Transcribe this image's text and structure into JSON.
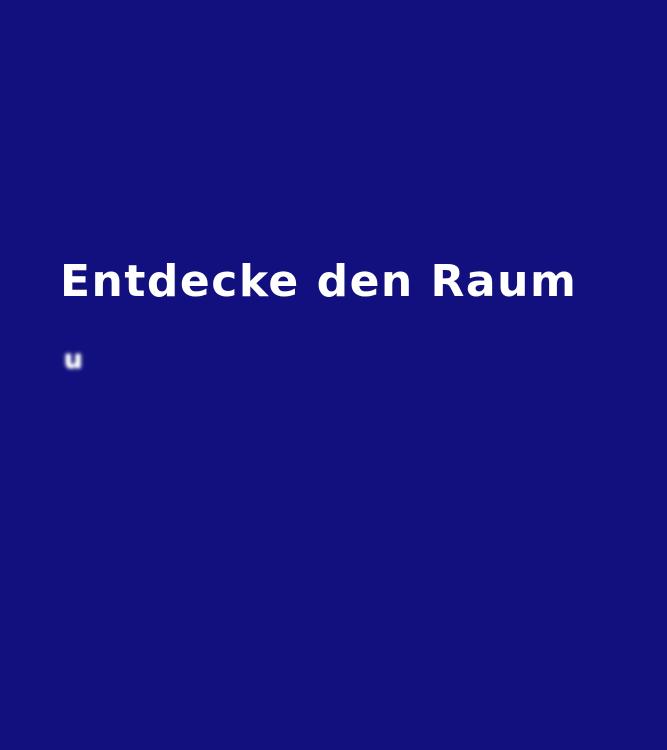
{
  "colors": {
    "background": "#12107e",
    "text": "#ffffff"
  },
  "hero": {
    "headline": "Entdecke den Raum",
    "typing_text": "u"
  }
}
